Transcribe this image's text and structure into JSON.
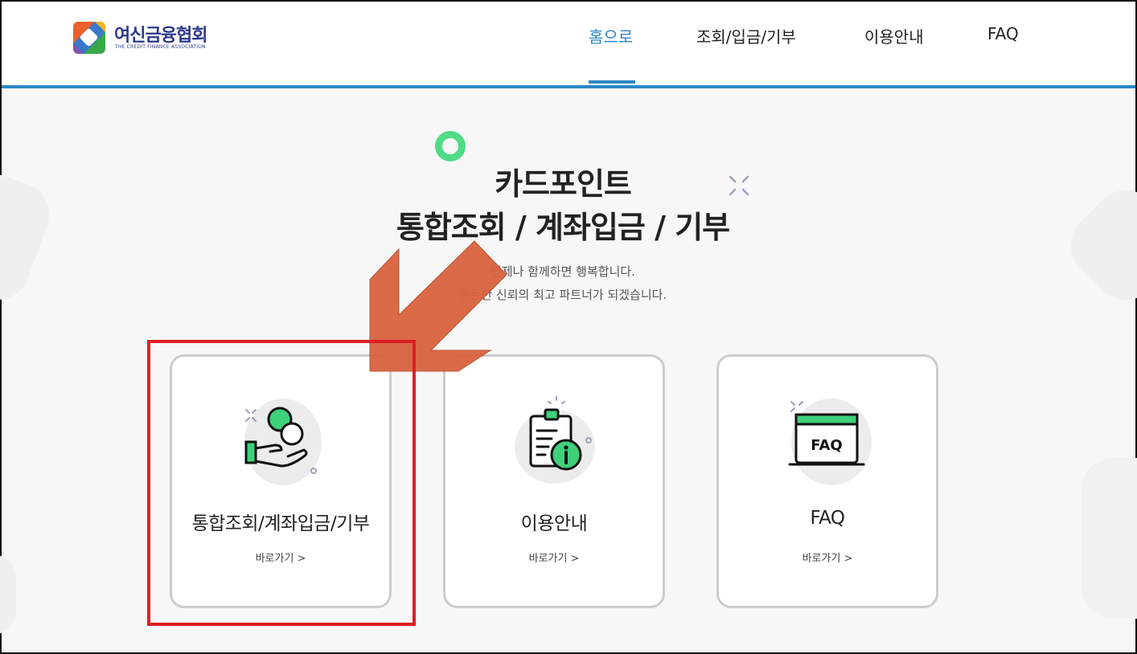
{
  "header": {
    "logo_ko": "여신금융협회",
    "logo_en": "THE CREDIT FINANCE ASSOCIATION",
    "nav": [
      {
        "label": "홈으로",
        "active": true
      },
      {
        "label": "조회/입금/기부",
        "active": false
      },
      {
        "label": "이용안내",
        "active": false
      },
      {
        "label": "FAQ",
        "active": false
      }
    ]
  },
  "hero": {
    "title_line1": "카드포인트",
    "title_line2": "통합조회 / 계좌입금 / 기부",
    "sub_line1": "언제나 함께하면 행복합니다.",
    "sub_line2": "든든한 신뢰의 최고 파트너가 되겠습니다."
  },
  "cards": [
    {
      "title": "통합조회/계좌입금/기부",
      "link": "바로가기 >",
      "icon": "hand-coin-icon"
    },
    {
      "title": "이용안내",
      "link": "바로가기 >",
      "icon": "clipboard-info-icon"
    },
    {
      "title": "FAQ",
      "link": "바로가기 >",
      "icon": "faq-window-icon"
    }
  ],
  "icon_text": {
    "faq": "FAQ"
  },
  "colors": {
    "accent": "#2b86c5",
    "green": "#3fd07a",
    "highlight": "#e01e25",
    "arrow": "#d9623f"
  }
}
